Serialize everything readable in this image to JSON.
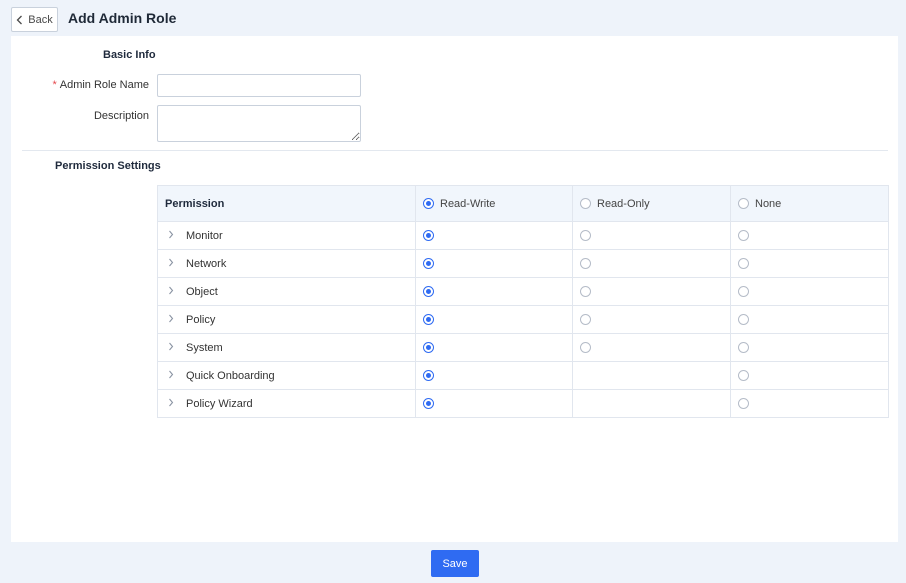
{
  "header": {
    "back_label": "Back",
    "title": "Add Admin Role"
  },
  "basic_info": {
    "section_title": "Basic Info",
    "name_label": "Admin Role Name",
    "name_required_mark": "*",
    "name_value": "",
    "description_label": "Description",
    "description_value": ""
  },
  "permissions": {
    "section_title": "Permission Settings",
    "columns": {
      "permission": "Permission",
      "read_write": "Read-Write",
      "read_only": "Read-Only",
      "none": "None"
    },
    "header_selected": "read_write",
    "rows": [
      {
        "label": "Monitor",
        "selected": "read_write",
        "has_read_only": true
      },
      {
        "label": "Network",
        "selected": "read_write",
        "has_read_only": true
      },
      {
        "label": "Object",
        "selected": "read_write",
        "has_read_only": true
      },
      {
        "label": "Policy",
        "selected": "read_write",
        "has_read_only": true
      },
      {
        "label": "System",
        "selected": "read_write",
        "has_read_only": true
      },
      {
        "label": "Quick Onboarding",
        "selected": "read_write",
        "has_read_only": false
      },
      {
        "label": "Policy Wizard",
        "selected": "read_write",
        "has_read_only": false
      }
    ]
  },
  "footer": {
    "save_label": "Save"
  },
  "colors": {
    "accent": "#2f6bf2",
    "background": "#eef3fa",
    "required": "#e5484d"
  }
}
